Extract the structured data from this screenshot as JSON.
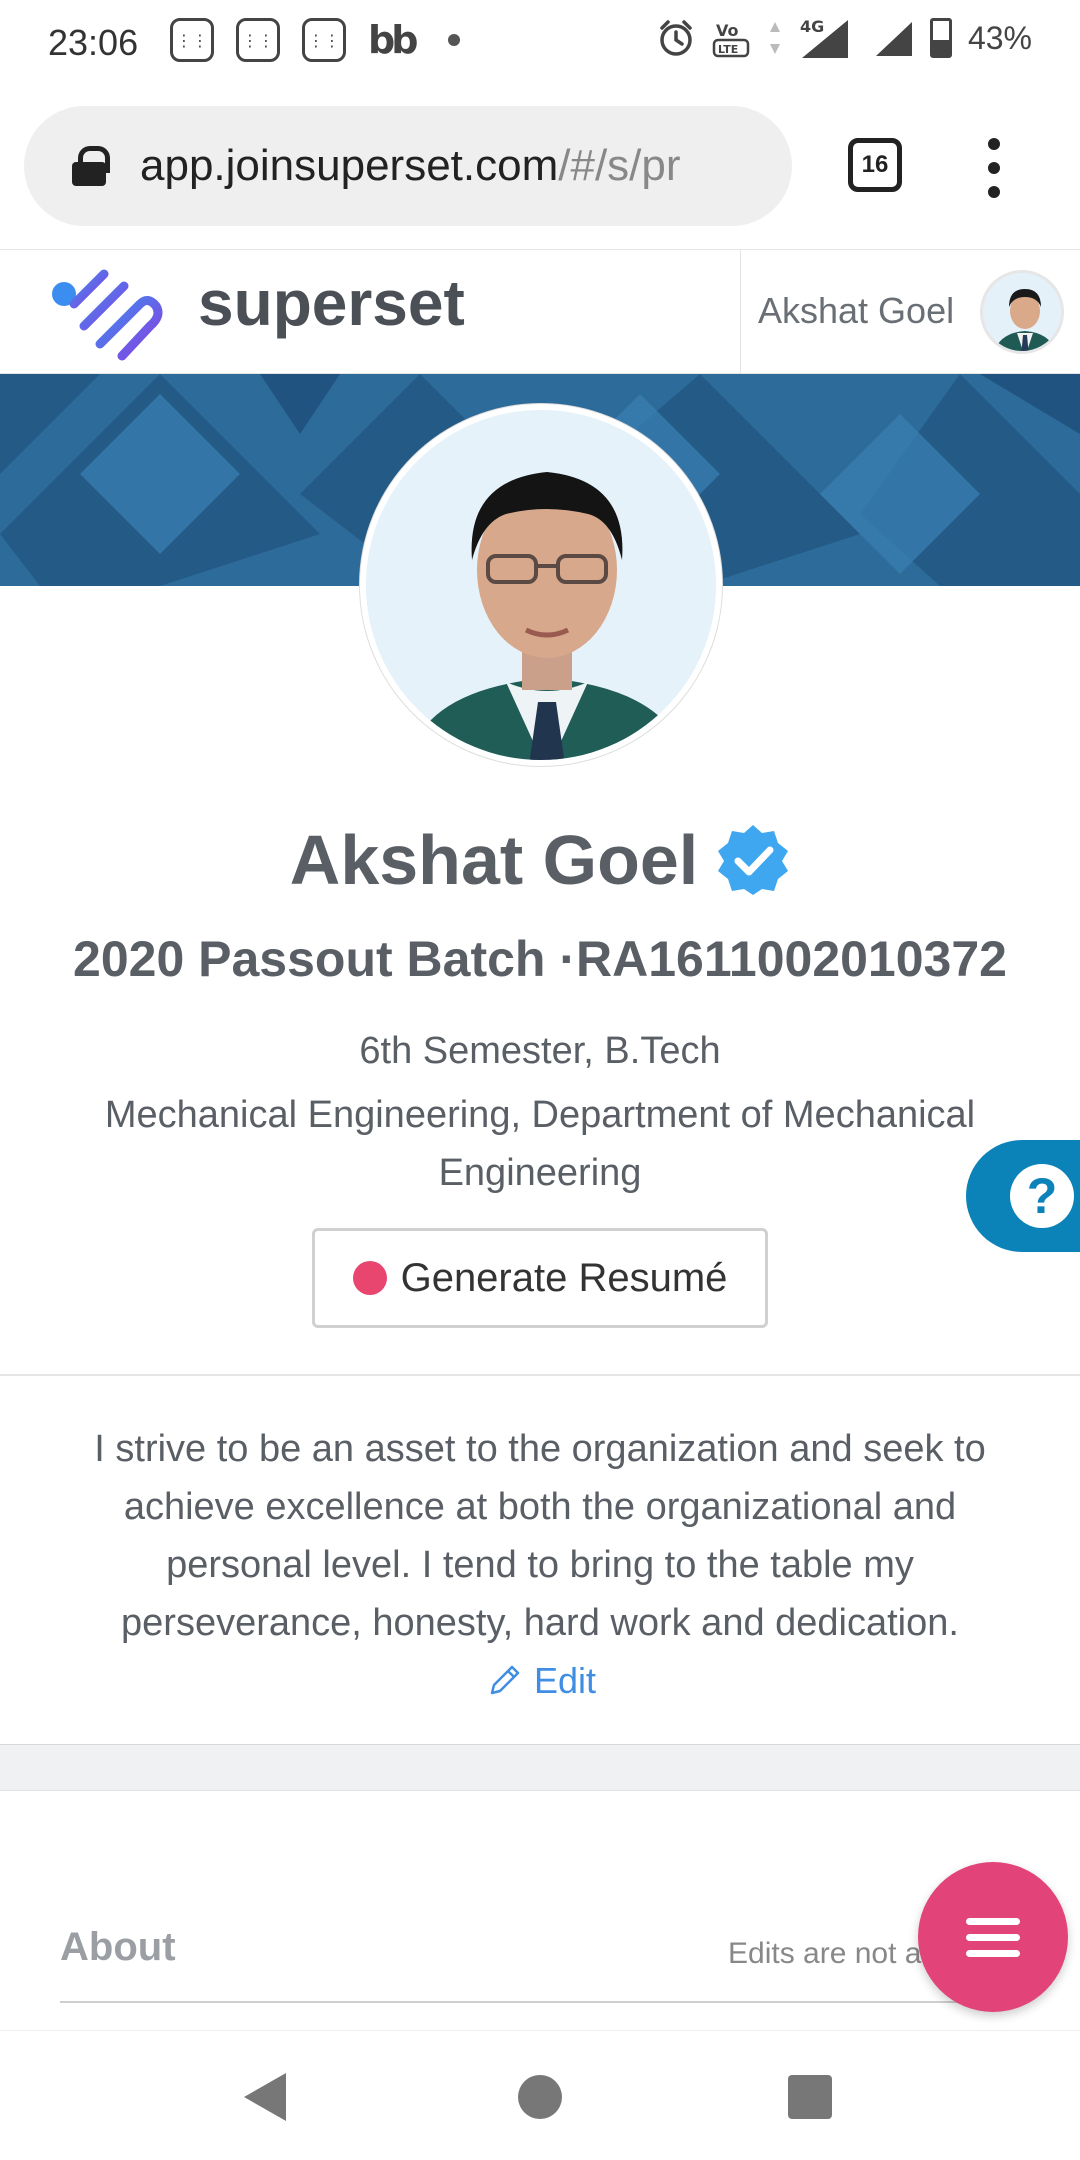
{
  "status_bar": {
    "time": "23:06",
    "battery_pct": "43%",
    "network": "4G",
    "volte": "VoLTE",
    "notif_bb": "bb"
  },
  "browser": {
    "url_host": "app.joinsuperset.com",
    "url_path": "/#/s/pr",
    "tab_count": "16"
  },
  "app_header": {
    "brand": "superset",
    "user_name": "Akshat Goel"
  },
  "profile": {
    "name": "Akshat Goel",
    "batch": "2020 Passout Batch ·RA1611002010372",
    "semester": "6th Semester, B.Tech",
    "department": "Mechanical Engineering, Department of Mechanical Engineering",
    "generate_resume_label": "Generate Resumé",
    "bio": "I strive to be an asset to the organization and seek to achieve excellence at both the organizational and personal level. I tend to bring to the table my perseverance, honesty, hard work and dedication.",
    "edit_label": "Edit"
  },
  "about": {
    "title": "About",
    "note": "Edits are not a"
  },
  "help": {
    "glyph": "?"
  },
  "colors": {
    "accent_pink": "#e2447a",
    "help_blue": "#0b82b8",
    "link_blue": "#3f8ee3",
    "verified_blue": "#3ea7f0"
  }
}
